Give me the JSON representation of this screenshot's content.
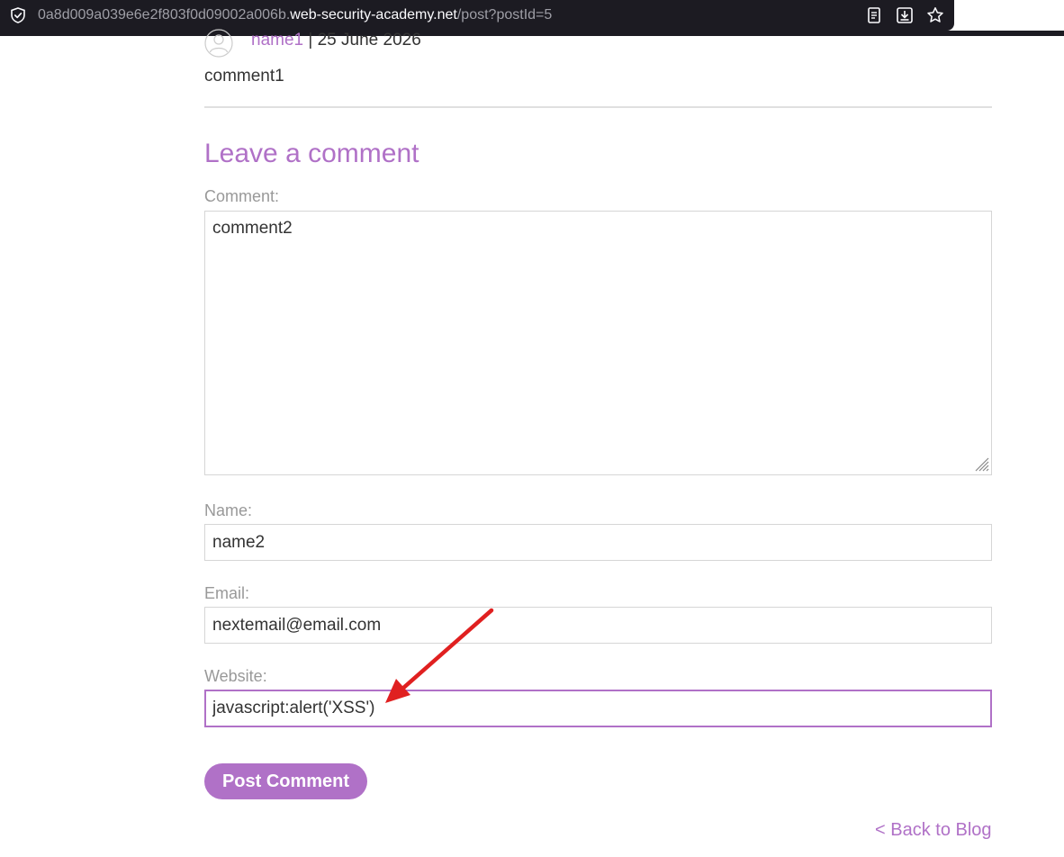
{
  "browser": {
    "url_prefix": "0a8d009a039e6e2f803f0d09002a006b.",
    "url_host": "web-security-academy.net",
    "url_path": "/post?postId=5"
  },
  "previous_comment": {
    "author": "name1",
    "separator": " | ",
    "date": "25 June 2026",
    "body": "comment1"
  },
  "comment_form": {
    "title": "Leave a comment",
    "comment_label": "Comment:",
    "comment_value": "comment2",
    "name_label": "Name:",
    "name_value": "name2",
    "email_label": "Email:",
    "email_value": "nextemail@email.com",
    "website_label": "Website:",
    "website_value": "javascript:alert('XSS')",
    "submit_label": "Post Comment"
  },
  "navigation": {
    "back_link": "< Back to Blog"
  },
  "colors": {
    "accent": "#b071c7",
    "annotation_arrow": "#e02020",
    "browser_chrome": "#1c1b22"
  },
  "icons": {
    "url_security": "shield-check-icon",
    "reader_view": "reader-view-icon",
    "download": "download-icon",
    "bookmark": "star-icon",
    "avatar": "user-avatar-icon"
  }
}
